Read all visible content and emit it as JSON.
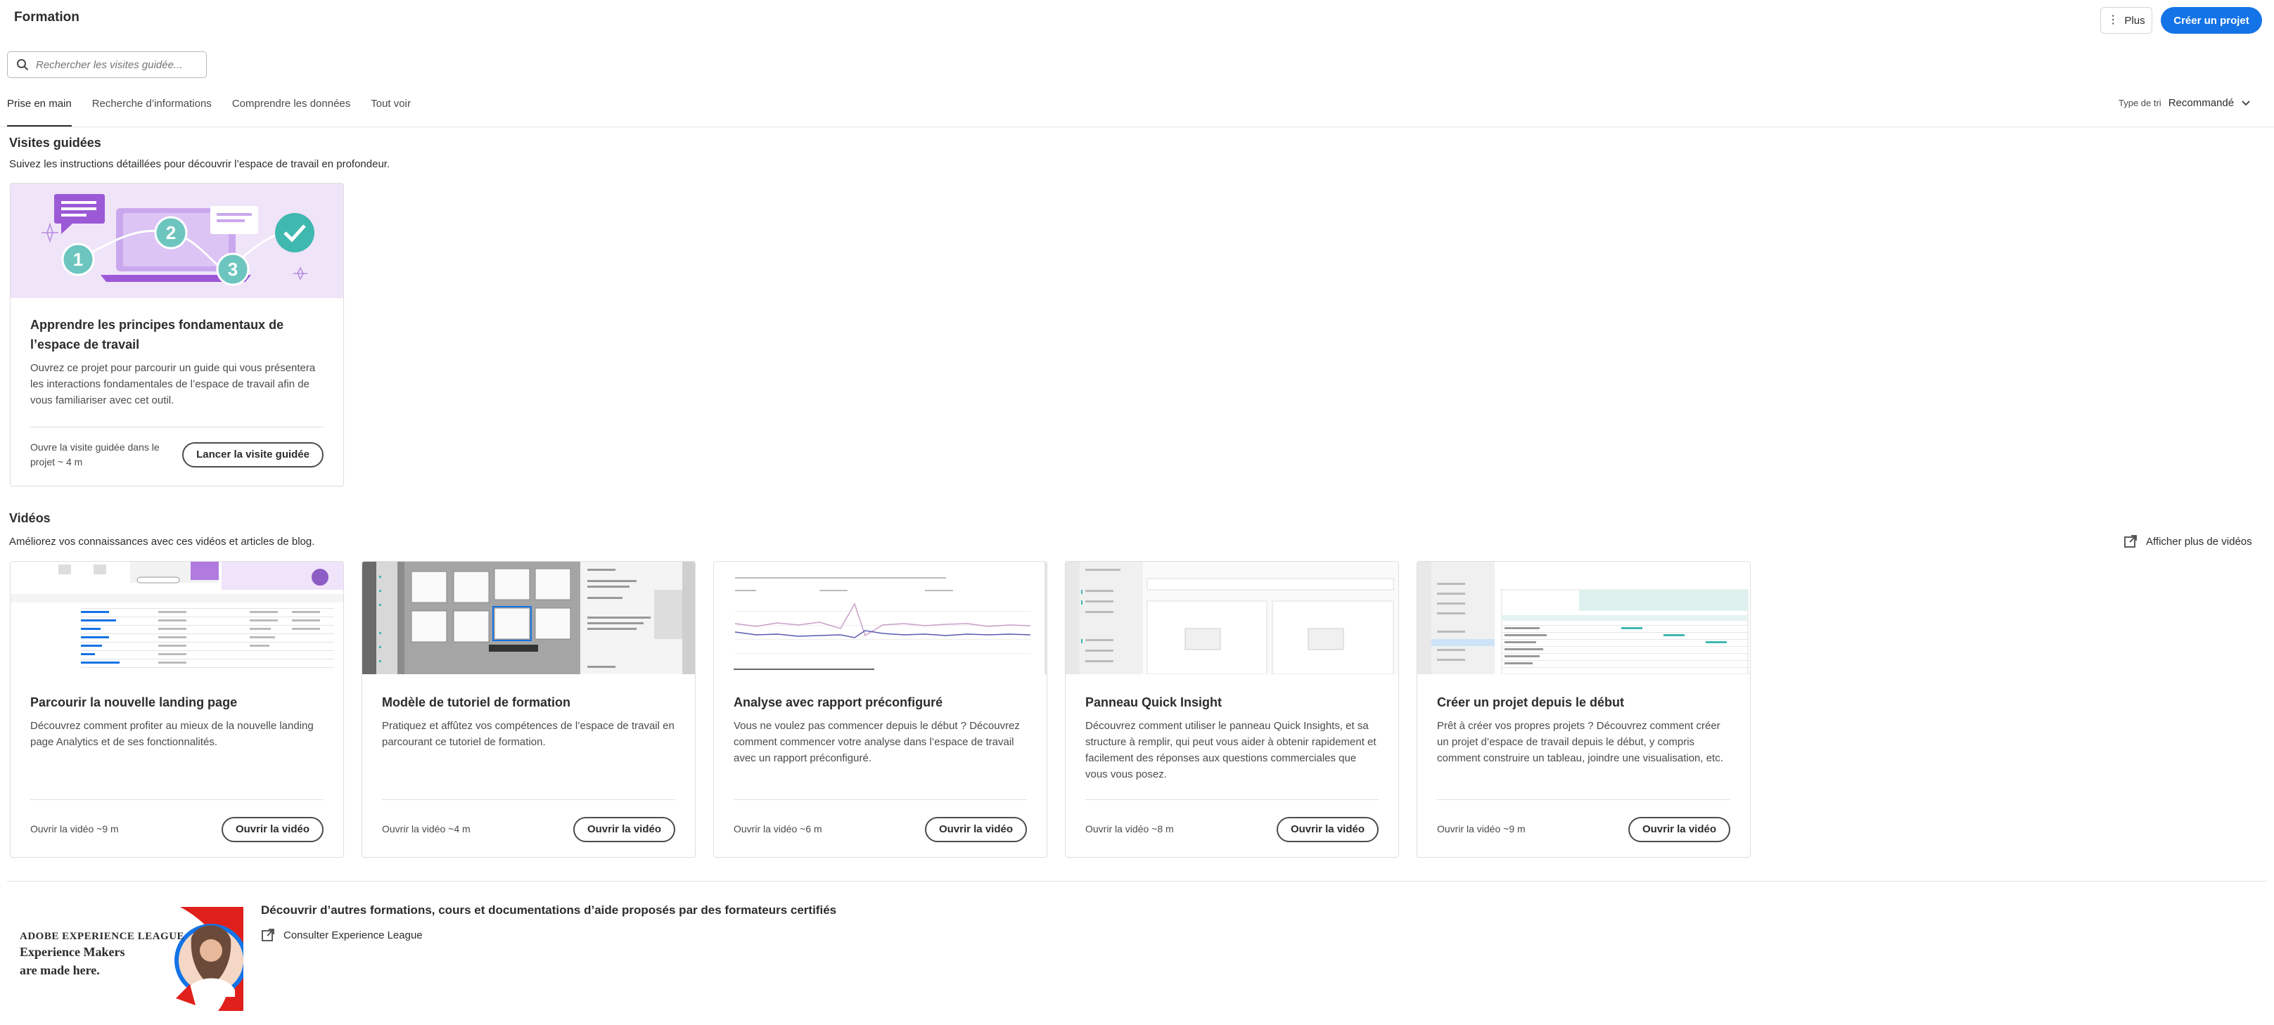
{
  "header": {
    "title": "Formation",
    "more_label": "Plus",
    "create_label": "Créer un projet"
  },
  "search": {
    "placeholder": "Rechercher les visites guidée..."
  },
  "tabs": [
    {
      "label": "Prise en main",
      "active": true
    },
    {
      "label": "Recherche d’informations",
      "active": false
    },
    {
      "label": "Comprendre les données",
      "active": false
    },
    {
      "label": "Tout voir",
      "active": false
    }
  ],
  "sort": {
    "label": "Type de tri",
    "value": "Recommandé"
  },
  "guided": {
    "title": "Visites guidées",
    "description": "Suivez les instructions détaillées pour découvrir l’espace de travail en profondeur.",
    "card": {
      "title": "Apprendre les principes fondamentaux de l’espace de travail",
      "description": "Ouvrez ce projet pour parcourir un guide qui vous présentera les interactions fondamentales de l’espace de travail afin de vous familiariser avec cet outil.",
      "meta_line1": "Ouvre la visite guidée dans le",
      "meta_line2": "projet ~ 4 m",
      "button": "Lancer la visite guidée",
      "steps": [
        "1",
        "2",
        "3"
      ]
    }
  },
  "videos": {
    "title": "Vidéos",
    "description": "Améliorez vos connaissances avec ces vidéos et articles de blog.",
    "more_link": "Afficher plus de vidéos",
    "items": [
      {
        "title": "Parcourir la nouvelle landing page",
        "description": "Découvrez comment profiter au mieux de la nouvelle landing page Analytics et de ses fonctionnalités.",
        "meta": "Ouvrir la vidéo ~9 m",
        "button": "Ouvrir la vidéo"
      },
      {
        "title": "Modèle de tutoriel de formation",
        "description": "Pratiquez et affûtez vos compétences de l’espace de travail en parcourant ce tutoriel de formation.",
        "meta": "Ouvrir la vidéo ~4 m",
        "button": "Ouvrir la vidéo"
      },
      {
        "title": "Analyse avec rapport préconfiguré",
        "description": "Vous ne voulez pas commencer depuis le début ? Découvrez comment commencer votre analyse dans l’espace de travail avec un rapport préconfiguré.",
        "meta": "Ouvrir la vidéo ~6 m",
        "button": "Ouvrir la vidéo"
      },
      {
        "title": "Panneau Quick Insight",
        "description": "Découvrez comment utiliser le panneau Quick Insights, et sa structure à remplir, qui peut vous aider à obtenir rapidement et facilement des réponses aux questions commerciales que vous vous posez.",
        "meta": "Ouvrir la vidéo ~8 m",
        "button": "Ouvrir la vidéo"
      },
      {
        "title": "Créer un projet depuis le début",
        "description": "Prêt à créer vos propres projets ? Découvrez comment créer un projet d’espace de travail depuis le début, y compris comment construire un tableau, joindre une visualisation, etc.",
        "meta": "Ouvrir la vidéo ~9 m",
        "button": "Ouvrir la vidéo"
      }
    ]
  },
  "league": {
    "banner_brand": "ADOBE EXPERIENCE LEAGUE",
    "banner_line1": "Experience Makers",
    "banner_line2": "are made here.",
    "title": "Découvrir d’autres formations, cours et documentations d’aide proposés par des formateurs certifiés",
    "link": "Consulter Experience League"
  },
  "colors": {
    "accent": "#1473e6",
    "illustration_bg": "#f0e4f8",
    "purple": "#9b59d6",
    "teal": "#3fb8b0",
    "red": "#e0201b"
  }
}
